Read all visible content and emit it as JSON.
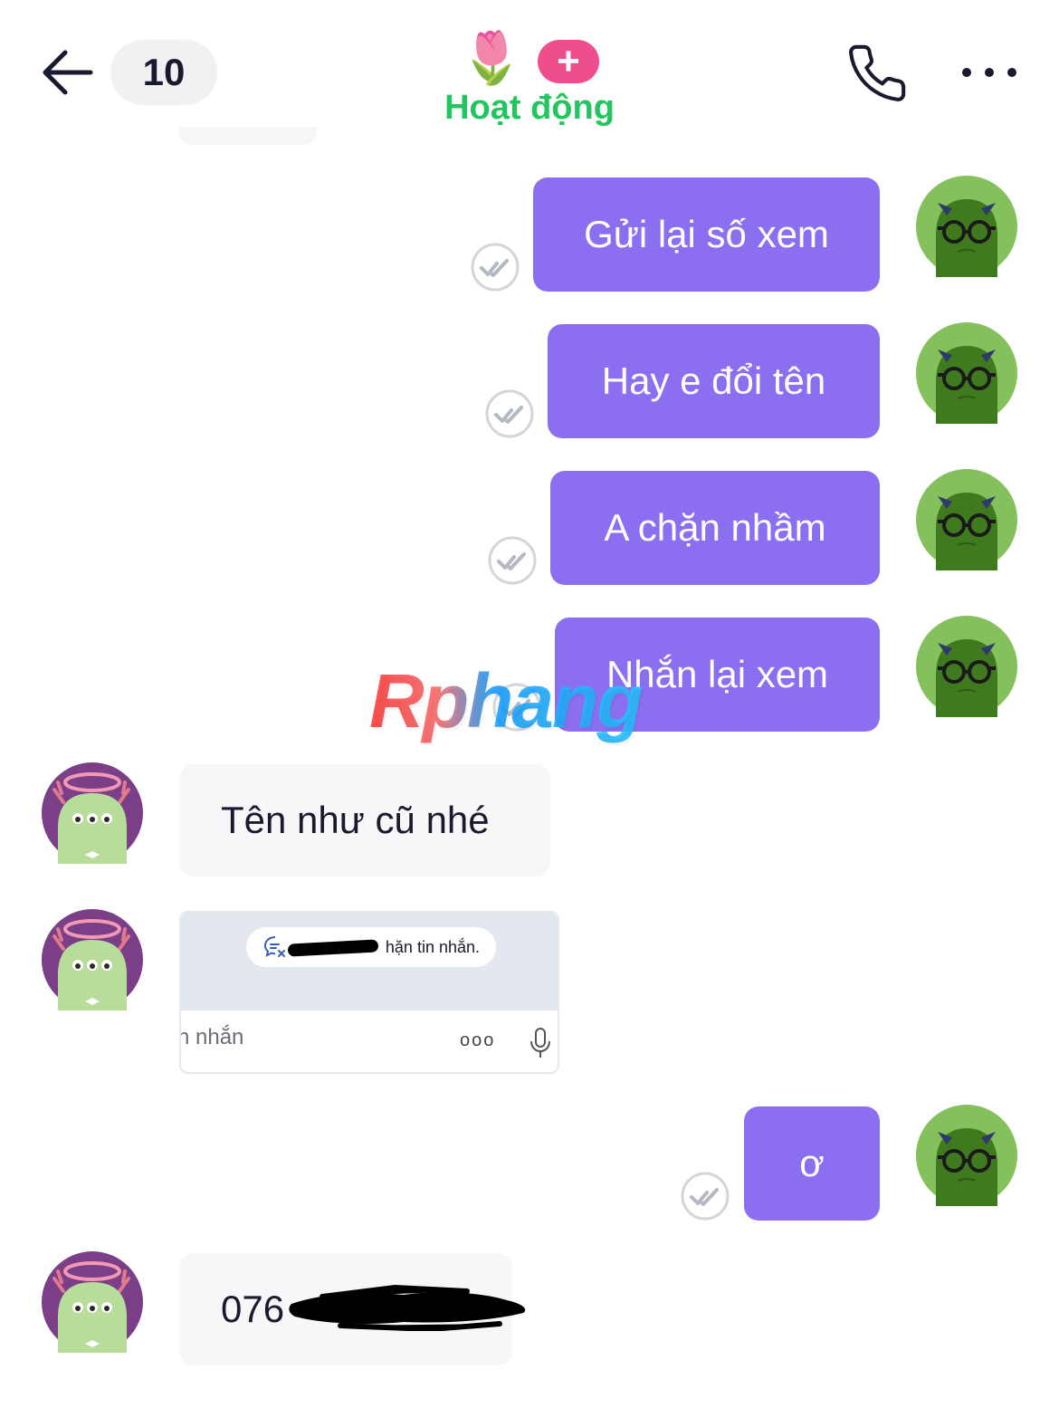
{
  "header": {
    "unread_count": "10",
    "status": "Hoạt động",
    "plus_label": "+",
    "tulip": "🌷"
  },
  "messages": {
    "sent": [
      {
        "text": "Gửi lại số xem"
      },
      {
        "text": "Hay e đổi tên"
      },
      {
        "text": "A chặn nhầm"
      },
      {
        "text": "Nhắn lại xem"
      },
      {
        "text": "ơ"
      }
    ],
    "received": [
      {
        "text": "Tên như cũ nhé"
      },
      {
        "text": "076"
      }
    ],
    "image_message": {
      "pill_text": "hặn tin nhắn.",
      "input_placeholder": "n nhắn",
      "dots": "ooo"
    }
  },
  "watermark": "Rphang",
  "colors": {
    "sent_bubble": "#8b6ff0",
    "received_bubble": "#f7f7f9",
    "status_green": "#22c55e",
    "plus_pink": "#ee4f8c"
  }
}
